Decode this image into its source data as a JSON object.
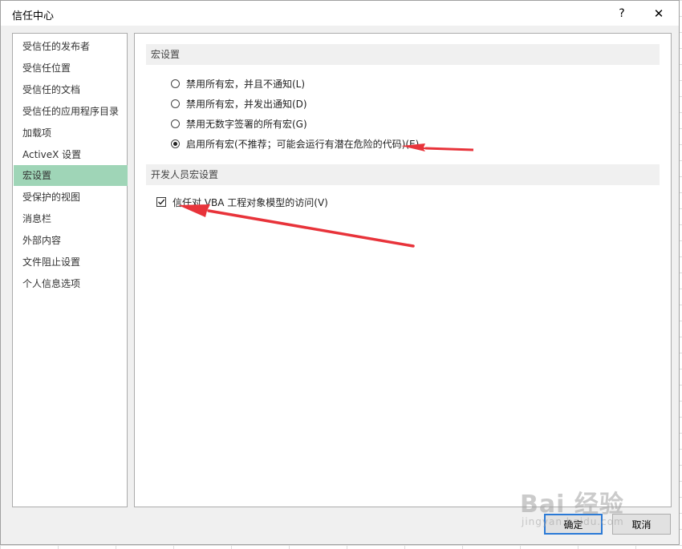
{
  "window": {
    "title": "信任中心",
    "help_label": "?",
    "close_label": "✕"
  },
  "sidebar": {
    "items": [
      {
        "label": "受信任的发布者",
        "active": false
      },
      {
        "label": "受信任位置",
        "active": false
      },
      {
        "label": "受信任的文档",
        "active": false
      },
      {
        "label": "受信任的应用程序目录",
        "active": false
      },
      {
        "label": "加载项",
        "active": false
      },
      {
        "label": "ActiveX 设置",
        "active": false
      },
      {
        "label": "宏设置",
        "active": true
      },
      {
        "label": "受保护的视图",
        "active": false
      },
      {
        "label": "消息栏",
        "active": false
      },
      {
        "label": "外部内容",
        "active": false
      },
      {
        "label": "文件阻止设置",
        "active": false
      },
      {
        "label": "个人信息选项",
        "active": false
      }
    ]
  },
  "macro_settings": {
    "header": "宏设置",
    "options": [
      {
        "label": "禁用所有宏，并且不通知(L)",
        "checked": false
      },
      {
        "label": "禁用所有宏，并发出通知(D)",
        "checked": false
      },
      {
        "label": "禁用无数字签署的所有宏(G)",
        "checked": false
      },
      {
        "label": "启用所有宏(不推荐；可能会运行有潜在危险的代码)(E)",
        "checked": true
      }
    ]
  },
  "developer_settings": {
    "header": "开发人员宏设置",
    "trust_vba_label": "信任对 VBA 工程对象模型的访问(V)",
    "trust_vba_checked": true
  },
  "footer": {
    "ok_label": "确定",
    "cancel_label": "取消"
  },
  "watermark": {
    "main": "Bai 经验",
    "sub": "jingyan.baidu.com"
  },
  "colors": {
    "active_item": "#9fd5b7",
    "annotation_arrow": "#e8333a",
    "primary_border": "#2a79d6"
  }
}
